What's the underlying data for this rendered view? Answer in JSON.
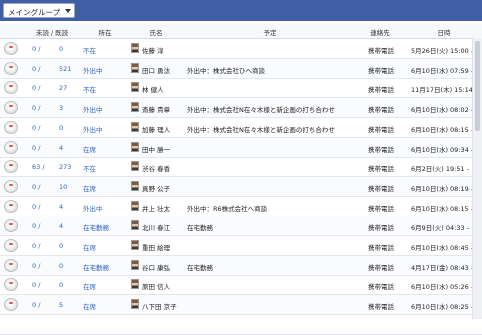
{
  "group_select": {
    "value": "メイングループ"
  },
  "headers": {
    "unread": "未読 / 既読",
    "status": "所在",
    "name": "氏名",
    "schedule": "予定",
    "contact": "連絡先",
    "datetime": "日時"
  },
  "rows": [
    {
      "unread": "0 /",
      "read": "0",
      "status": "不在",
      "name": "佐藤 淳",
      "schedule": "",
      "contact": "携帯電話",
      "datetime": "5月26日(火) 15:00 -"
    },
    {
      "unread": "0 /",
      "read": "521",
      "status": "外出中",
      "name": "田口 勇汰",
      "schedule": "外出中：株式会社ひへ商談",
      "contact": "携帯電話",
      "datetime": "6月10日(水) 07:59 -"
    },
    {
      "unread": "0 /",
      "read": "27",
      "status": "不在",
      "name": "林 健人",
      "schedule": "",
      "contact": "携帯電話",
      "datetime": "11月17日(木) 15:14 -"
    },
    {
      "unread": "0 /",
      "read": "3",
      "status": "外出中",
      "name": "斎藤 貴章",
      "schedule": "外出中：株式会社N在々木様と新企画の打ち合わせ",
      "contact": "携帯電話",
      "datetime": "6月10日(水) 08:02 -"
    },
    {
      "unread": "0 /",
      "read": "0",
      "status": "外出中",
      "name": "加藤 理人",
      "schedule": "外出中：株式会社N在々木様と新企画の打ち合わせ",
      "contact": "携帯電話",
      "datetime": "6月10日(水) 08:15 -"
    },
    {
      "unread": "0 /",
      "read": "4",
      "status": "在席",
      "name": "田中 勝一",
      "schedule": "",
      "contact": "携帯電話",
      "datetime": "6月10日(水) 09:34 -"
    },
    {
      "unread": "63 /",
      "read": "273",
      "status": "不在",
      "name": "渋谷 春香",
      "schedule": "",
      "contact": "携帯電話",
      "datetime": "6月2日(火) 19:51 -"
    },
    {
      "unread": "0 /",
      "read": "10",
      "status": "在席",
      "name": "真野 公子",
      "schedule": "",
      "contact": "携帯電話",
      "datetime": "6月10日(水) 08:19 -"
    },
    {
      "unread": "0 /",
      "read": "4",
      "status": "外出中",
      "name": "井上 壮太",
      "schedule": "外出中：R6株式会社へ商談",
      "contact": "携帯電話",
      "datetime": "6月10日(水) 08:15 -"
    },
    {
      "unread": "0 /",
      "read": "4",
      "status": "在宅勤務",
      "name": "北川 春江",
      "schedule": "在宅勤務",
      "contact": "携帯電話",
      "datetime": "6月9日(火) 04:33 -"
    },
    {
      "unread": "0 /",
      "read": "0",
      "status": "在席",
      "name": "重田 絵理",
      "schedule": "",
      "contact": "携帯電話",
      "datetime": "6月10日(水) 08:45 -"
    },
    {
      "unread": "0 /",
      "read": "0",
      "status": "在宅勤務",
      "name": "谷口 康弘",
      "schedule": "在宅勤務",
      "contact": "携帯電話",
      "datetime": "4月17日(金) 08:43 -"
    },
    {
      "unread": "0 /",
      "read": "0",
      "status": "在席",
      "name": "原田 信人",
      "schedule": "",
      "contact": "携帯電話",
      "datetime": "6月10日(水) 05:26 -"
    },
    {
      "unread": "0 /",
      "read": "5",
      "status": "在席",
      "name": "八下田 京子",
      "schedule": "",
      "contact": "携帯電話",
      "datetime": "6月10日(水) 08:25 -"
    },
    {
      "unread": "",
      "read": "",
      "status": "",
      "name": "",
      "schedule": "",
      "contact": "",
      "datetime": ""
    }
  ]
}
